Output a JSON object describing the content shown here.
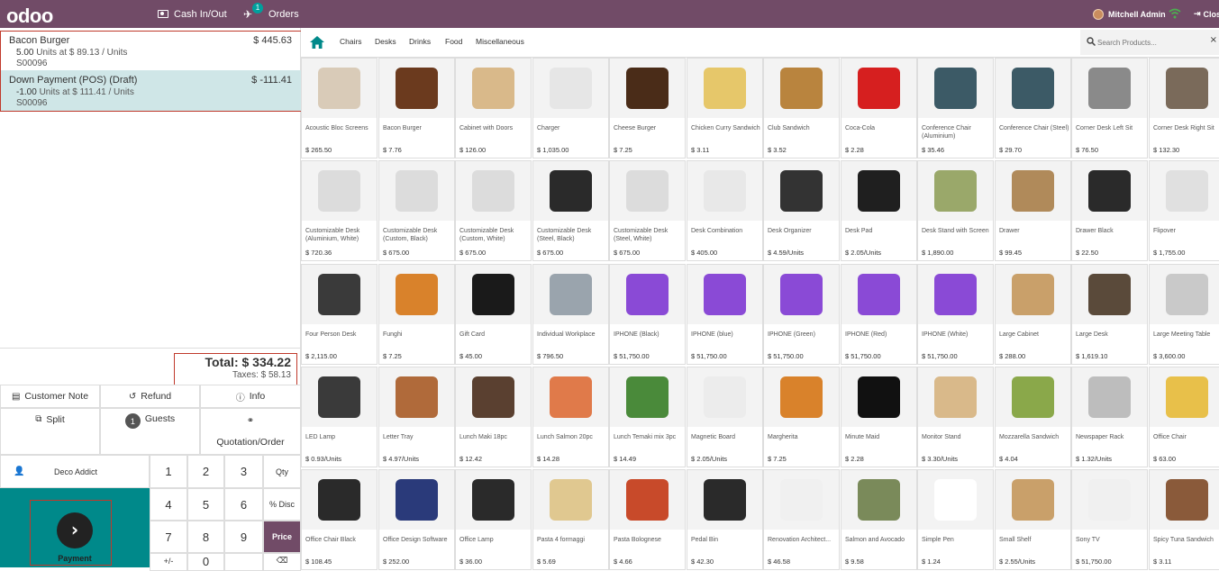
{
  "topbar": {
    "logo": "odoo",
    "cash_label": "Cash In/Out",
    "orders_label": "Orders",
    "orders_badge": "1",
    "user_name": "Mitchell Admin",
    "close_label": "Close"
  },
  "order": {
    "lines": [
      {
        "name": "Bacon Burger",
        "price": "$ 445.63",
        "qty_prefix": "5.00",
        "qty_suffix": " Units at $ 89.13 / Units",
        "ref": "S00096",
        "selected": false
      },
      {
        "name": "Down Payment (POS) (Draft)",
        "price": "$ -111.41",
        "qty_prefix": "-1.00",
        "qty_suffix": " Units at $ 111.41 / Units",
        "ref": "S00096",
        "selected": true
      }
    ],
    "total": "Total: $ 334.22",
    "taxes": "Taxes: $ 58.13"
  },
  "controls": {
    "customer_note": "Customer Note",
    "refund": "Refund",
    "info": "Info",
    "split": "Split",
    "guests_count": "1",
    "guests": "Guests",
    "quotation": "Quotation/Order",
    "customer": "Deco Addict",
    "payment": "Payment"
  },
  "numpad": {
    "k1": "1",
    "k2": "2",
    "k3": "3",
    "qty": "Qty",
    "k4": "4",
    "k5": "5",
    "k6": "6",
    "disc": "% Disc",
    "k7": "7",
    "k8": "8",
    "k9": "9",
    "price": "Price",
    "plusminus": "+/-",
    "k0": "0",
    "bksp": "⌫"
  },
  "categories": [
    "Chairs",
    "Desks",
    "Drinks",
    "Food",
    "Miscellaneous"
  ],
  "search": {
    "placeholder": "Search Products..."
  },
  "products": [
    {
      "name": "Acoustic Bloc Screens",
      "price": "$ 265.50",
      "color": "#d9cbb8"
    },
    {
      "name": "Bacon Burger",
      "price": "$ 7.76",
      "color": "#6b3a1e"
    },
    {
      "name": "Cabinet with Doors",
      "price": "$ 126.00",
      "color": "#d9b98a"
    },
    {
      "name": "Charger",
      "price": "$ 1,035.00",
      "color": "#e6e6e6"
    },
    {
      "name": "Cheese Burger",
      "price": "$ 7.25",
      "color": "#4a2c18"
    },
    {
      "name": "Chicken Curry Sandwich",
      "price": "$ 3.11",
      "color": "#e6c76a"
    },
    {
      "name": "Club Sandwich",
      "price": "$ 3.52",
      "color": "#b9843e"
    },
    {
      "name": "Coca-Cola",
      "price": "$ 2.28",
      "color": "#d61f1f"
    },
    {
      "name": "Conference Chair (Aluminium)",
      "price": "$ 35.46",
      "color": "#3c5a66"
    },
    {
      "name": "Conference Chair (Steel)",
      "price": "$ 29.70",
      "color": "#3c5a66"
    },
    {
      "name": "Corner Desk Left Sit",
      "price": "$ 76.50",
      "color": "#8a8a8a"
    },
    {
      "name": "Corner Desk Right Sit",
      "price": "$ 132.30",
      "color": "#7a6a5a"
    },
    {
      "name": "Customizable Desk (Aluminium, White)",
      "price": "$ 720.36",
      "color": "#dcdcdc"
    },
    {
      "name": "Customizable Desk (Custom, Black)",
      "price": "$ 675.00",
      "color": "#dcdcdc"
    },
    {
      "name": "Customizable Desk (Custom, White)",
      "price": "$ 675.00",
      "color": "#dcdcdc"
    },
    {
      "name": "Customizable Desk (Steel, Black)",
      "price": "$ 675.00",
      "color": "#2a2a2a"
    },
    {
      "name": "Customizable Desk (Steel, White)",
      "price": "$ 675.00",
      "color": "#dcdcdc"
    },
    {
      "name": "Desk Combination",
      "price": "$ 405.00",
      "color": "#e8e8e8"
    },
    {
      "name": "Desk Organizer",
      "price": "$ 4.59/Units",
      "color": "#333333"
    },
    {
      "name": "Desk Pad",
      "price": "$ 2.05/Units",
      "color": "#1f1f1f"
    },
    {
      "name": "Desk Stand with Screen",
      "price": "$ 1,890.00",
      "color": "#9aa86a"
    },
    {
      "name": "Drawer",
      "price": "$ 99.45",
      "color": "#b08a5a"
    },
    {
      "name": "Drawer Black",
      "price": "$ 22.50",
      "color": "#2a2a2a"
    },
    {
      "name": "Flipover",
      "price": "$ 1,755.00",
      "color": "#e0e0e0"
    },
    {
      "name": "Four Person Desk",
      "price": "$ 2,115.00",
      "color": "#3a3a3a"
    },
    {
      "name": "Funghi",
      "price": "$ 7.25",
      "color": "#d9822b"
    },
    {
      "name": "Gift Card",
      "price": "$ 45.00",
      "color": "#1a1a1a"
    },
    {
      "name": "Individual Workplace",
      "price": "$ 796.50",
      "color": "#9aa4ad"
    },
    {
      "name": "IPHONE (Black)",
      "price": "$ 51,750.00",
      "color": "#8a4ad6"
    },
    {
      "name": "IPHONE (blue)",
      "price": "$ 51,750.00",
      "color": "#8a4ad6"
    },
    {
      "name": "IPHONE (Green)",
      "price": "$ 51,750.00",
      "color": "#8a4ad6"
    },
    {
      "name": "IPHONE (Red)",
      "price": "$ 51,750.00",
      "color": "#8a4ad6"
    },
    {
      "name": "IPHONE (White)",
      "price": "$ 51,750.00",
      "color": "#8a4ad6"
    },
    {
      "name": "Large Cabinet",
      "price": "$ 288.00",
      "color": "#c9a06a"
    },
    {
      "name": "Large Desk",
      "price": "$ 1,619.10",
      "color": "#5a4a3a"
    },
    {
      "name": "Large Meeting Table",
      "price": "$ 3,600.00",
      "color": "#c9c9c9"
    },
    {
      "name": "LED Lamp",
      "price": "$ 0.93/Units",
      "color": "#3a3a3a"
    },
    {
      "name": "Letter Tray",
      "price": "$ 4.97/Units",
      "color": "#b06a3a"
    },
    {
      "name": "Lunch Maki 18pc",
      "price": "$ 12.42",
      "color": "#5a4030"
    },
    {
      "name": "Lunch Salmon 20pc",
      "price": "$ 14.28",
      "color": "#e07a4a"
    },
    {
      "name": "Lunch Temaki mix 3pc",
      "price": "$ 14.49",
      "color": "#4a8a3a"
    },
    {
      "name": "Magnetic Board",
      "price": "$ 2.05/Units",
      "color": "#ececec"
    },
    {
      "name": "Margherita",
      "price": "$ 7.25",
      "color": "#d9822b"
    },
    {
      "name": "Minute Maid",
      "price": "$ 2.28",
      "color": "#111111"
    },
    {
      "name": "Monitor Stand",
      "price": "$ 3.30/Units",
      "color": "#d9b98a"
    },
    {
      "name": "Mozzarella Sandwich",
      "price": "$ 4.04",
      "color": "#8aa84a"
    },
    {
      "name": "Newspaper Rack",
      "price": "$ 1.32/Units",
      "color": "#bdbdbd"
    },
    {
      "name": "Office Chair",
      "price": "$ 63.00",
      "color": "#e8c04a"
    },
    {
      "name": "Office Chair Black",
      "price": "$ 108.45",
      "color": "#2a2a2a"
    },
    {
      "name": "Office Design Software",
      "price": "$ 252.00",
      "color": "#2a3a7a"
    },
    {
      "name": "Office Lamp",
      "price": "$ 36.00",
      "color": "#2a2a2a"
    },
    {
      "name": "Pasta 4 formaggi",
      "price": "$ 5.69",
      "color": "#e0c890"
    },
    {
      "name": "Pasta Bolognese",
      "price": "$ 4.66",
      "color": "#c84a2a"
    },
    {
      "name": "Pedal Bin",
      "price": "$ 42.30",
      "color": "#2a2a2a"
    },
    {
      "name": "Renovation Architect...",
      "price": "$ 46.58",
      "color": "#f0f0f0"
    },
    {
      "name": "Salmon and Avocado",
      "price": "$ 9.58",
      "color": "#7a8a5a"
    },
    {
      "name": "Simple Pen",
      "price": "$ 1.24",
      "color": "#ffffff"
    },
    {
      "name": "Small Shelf",
      "price": "$ 2.55/Units",
      "color": "#c9a06a"
    },
    {
      "name": "Sony TV",
      "price": "$ 51,750.00",
      "color": "#f0f0f0"
    },
    {
      "name": "Spicy Tuna Sandwich",
      "price": "$ 3.11",
      "color": "#8a5a3a"
    }
  ],
  "colors": {
    "brand": "#714B67",
    "accent": "#00A09D",
    "payment": "#00898a",
    "selected_line": "#cfe6e7"
  }
}
